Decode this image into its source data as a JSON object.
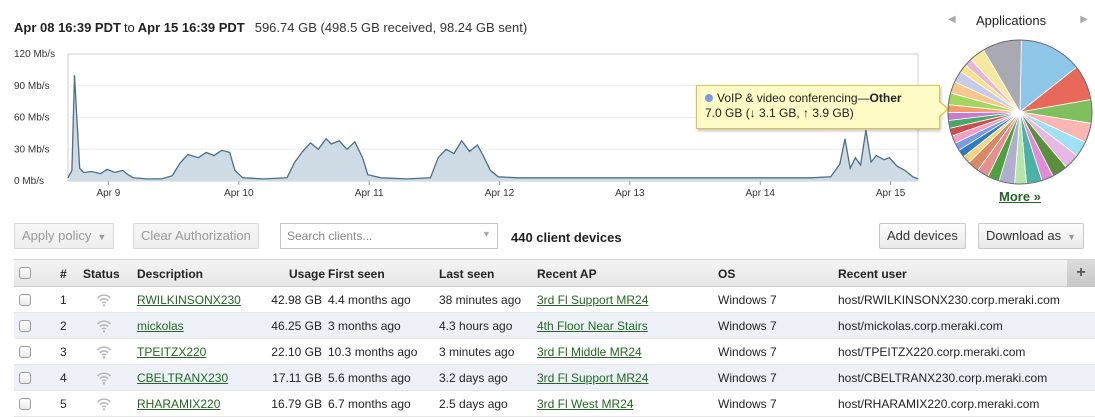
{
  "summary": {
    "from": "Apr 08 16:39 PDT",
    "to_word": "to",
    "to": "Apr 15 16:39 PDT",
    "total": "596.74 GB (498.5 GB received, 98.24 GB sent)"
  },
  "chart_data": {
    "type": "area",
    "ylabel": "",
    "y_ticks": [
      "0 Mb/s",
      "30 Mb/s",
      "60 Mb/s",
      "90 Mb/s",
      "120 Mb/s"
    ],
    "x_ticks": [
      "Apr 9",
      "Apr 10",
      "Apr 11",
      "Apr 12",
      "Apr 13",
      "Apr 14",
      "Apr 15"
    ],
    "ylim": [
      0,
      120
    ],
    "x_unit": "days since Apr 08 16:39",
    "series": [
      {
        "points": [
          [
            0.0,
            3
          ],
          [
            0.03,
            10
          ],
          [
            0.05,
            100
          ],
          [
            0.07,
            55
          ],
          [
            0.09,
            12
          ],
          [
            0.12,
            8
          ],
          [
            0.18,
            9
          ],
          [
            0.25,
            7
          ],
          [
            0.3,
            11
          ],
          [
            0.36,
            8
          ],
          [
            0.42,
            10
          ],
          [
            0.46,
            6
          ],
          [
            0.5,
            3
          ],
          [
            0.6,
            2
          ],
          [
            0.72,
            2
          ],
          [
            0.8,
            5
          ],
          [
            0.86,
            17
          ],
          [
            0.92,
            25
          ],
          [
            1.0,
            22
          ],
          [
            1.06,
            27
          ],
          [
            1.12,
            24
          ],
          [
            1.18,
            29
          ],
          [
            1.24,
            27
          ],
          [
            1.28,
            10
          ],
          [
            1.34,
            3
          ],
          [
            1.5,
            2
          ],
          [
            1.68,
            3
          ],
          [
            1.74,
            18
          ],
          [
            1.8,
            28
          ],
          [
            1.86,
            36
          ],
          [
            1.92,
            30
          ],
          [
            1.98,
            40
          ],
          [
            2.02,
            35
          ],
          [
            2.08,
            38
          ],
          [
            2.14,
            30
          ],
          [
            2.2,
            37
          ],
          [
            2.26,
            22
          ],
          [
            2.3,
            6
          ],
          [
            2.4,
            3
          ],
          [
            2.6,
            2
          ],
          [
            2.78,
            3
          ],
          [
            2.84,
            22
          ],
          [
            2.9,
            30
          ],
          [
            2.96,
            26
          ],
          [
            3.02,
            38
          ],
          [
            3.08,
            28
          ],
          [
            3.14,
            34
          ],
          [
            3.18,
            25
          ],
          [
            3.24,
            10
          ],
          [
            3.3,
            4
          ],
          [
            3.45,
            3
          ],
          [
            3.7,
            3
          ],
          [
            3.95,
            3
          ],
          [
            4.2,
            3
          ],
          [
            4.45,
            3
          ],
          [
            4.7,
            3
          ],
          [
            4.95,
            3
          ],
          [
            5.2,
            3
          ],
          [
            5.45,
            3
          ],
          [
            5.7,
            3
          ],
          [
            5.85,
            4
          ],
          [
            5.92,
            16
          ],
          [
            5.96,
            40
          ],
          [
            6.0,
            12
          ],
          [
            6.04,
            22
          ],
          [
            6.08,
            15
          ],
          [
            6.12,
            48
          ],
          [
            6.16,
            18
          ],
          [
            6.2,
            24
          ],
          [
            6.26,
            20
          ],
          [
            6.3,
            22
          ],
          [
            6.36,
            14
          ],
          [
            6.42,
            10
          ],
          [
            6.48,
            4
          ],
          [
            6.52,
            2
          ]
        ]
      }
    ]
  },
  "tooltip": {
    "category": "VoIP & video conferencing",
    "dash": "—",
    "app": "Other",
    "detail": "7.0 GB (↓ 3.1 GB, ↑ 3.9 GB)",
    "dot_color": "#7b9be8"
  },
  "pie": {
    "title": "Applications",
    "prev_icon": "◀",
    "next_icon": "▶",
    "more": "More »",
    "slices": [
      {
        "value": 16,
        "color": "#8ec6e8"
      },
      {
        "value": 9,
        "color": "#e8685a"
      },
      {
        "value": 6,
        "color": "#7fbf5e"
      },
      {
        "value": 5,
        "color": "#fbb6b4"
      },
      {
        "value": 4,
        "color": "#9fe0f2"
      },
      {
        "value": 4,
        "color": "#e6b8e6"
      },
      {
        "value": 4,
        "color": "#5a8f3c"
      },
      {
        "value": 3,
        "color": "#e58ad6"
      },
      {
        "value": 4,
        "color": "#4ab3a5"
      },
      {
        "value": 3,
        "color": "#b7e4a8"
      },
      {
        "value": 4,
        "color": "#b0aed0"
      },
      {
        "value": 3,
        "color": "#4da23e"
      },
      {
        "value": 3,
        "color": "#e59090"
      },
      {
        "value": 3,
        "color": "#d98a65"
      },
      {
        "value": 2,
        "color": "#f3d47e"
      },
      {
        "value": 2,
        "color": "#2e7bbf"
      },
      {
        "value": 2,
        "color": "#7b9be8"
      },
      {
        "value": 2,
        "color": "#f0a0c0"
      },
      {
        "value": 2,
        "color": "#cc4d4d"
      },
      {
        "value": 2,
        "color": "#48a86a"
      },
      {
        "value": 2,
        "color": "#c77bd0"
      },
      {
        "value": 2,
        "color": "#f29b6a"
      },
      {
        "value": 3,
        "color": "#a4d65e"
      },
      {
        "value": 3,
        "color": "#f6c78a"
      },
      {
        "value": 3,
        "color": "#c9c9e8"
      },
      {
        "value": 2,
        "color": "#f7e08a"
      },
      {
        "value": 2,
        "color": "#e8b6d0"
      },
      {
        "value": 4,
        "color": "#f5e9a0"
      },
      {
        "value": 10,
        "color": "#a9a9b4"
      }
    ]
  },
  "toolbar": {
    "apply_policy": "Apply policy",
    "clear_authorization": "Clear Authorization",
    "search_placeholder": "Search clients...",
    "device_count": "440 client devices",
    "add_devices": "Add devices",
    "download_as": "Download as"
  },
  "table": {
    "columns": [
      "#",
      "Status",
      "Description",
      "Usage",
      "First seen",
      "Last seen",
      "Recent AP",
      "OS",
      "Recent user"
    ],
    "rows": [
      {
        "num": "1",
        "description": "RWILKINSONX230",
        "usage": "42.98 GB",
        "first_seen": "4.4 months ago",
        "last_seen": "38 minutes ago",
        "recent_ap": "3rd Fl Support MR24",
        "os": "Windows 7",
        "recent_user": "host/RWILKINSONX230.corp.meraki.com"
      },
      {
        "num": "2",
        "description": "mickolas",
        "usage": "46.25 GB",
        "first_seen": "3 months ago",
        "last_seen": "4.3 hours ago",
        "recent_ap": "4th Floor Near Stairs",
        "os": "Windows 7",
        "recent_user": "host/mickolas.corp.meraki.com"
      },
      {
        "num": "3",
        "description": "TPEITZX220",
        "usage": "22.10 GB",
        "first_seen": "10.3 months ago",
        "last_seen": "3 minutes ago",
        "recent_ap": "3rd Fl Middle MR24",
        "os": "Windows 7",
        "recent_user": "host/TPEITZX220.corp.meraki.com"
      },
      {
        "num": "4",
        "description": "CBELTRANX230",
        "usage": "17.11 GB",
        "first_seen": "5.6 months ago",
        "last_seen": "3.2 days ago",
        "recent_ap": "3rd Fl Support MR24",
        "os": "Windows 7",
        "recent_user": "host/CBELTRANX230.corp.meraki.com"
      },
      {
        "num": "5",
        "description": "RHARAMIX220",
        "usage": "16.79 GB",
        "first_seen": "6.7 months ago",
        "last_seen": "2.5 days ago",
        "recent_ap": "3rd Fl West MR24",
        "os": "Windows 7",
        "recent_user": "host/RHARAMIX220.corp.meraki.com"
      }
    ]
  }
}
